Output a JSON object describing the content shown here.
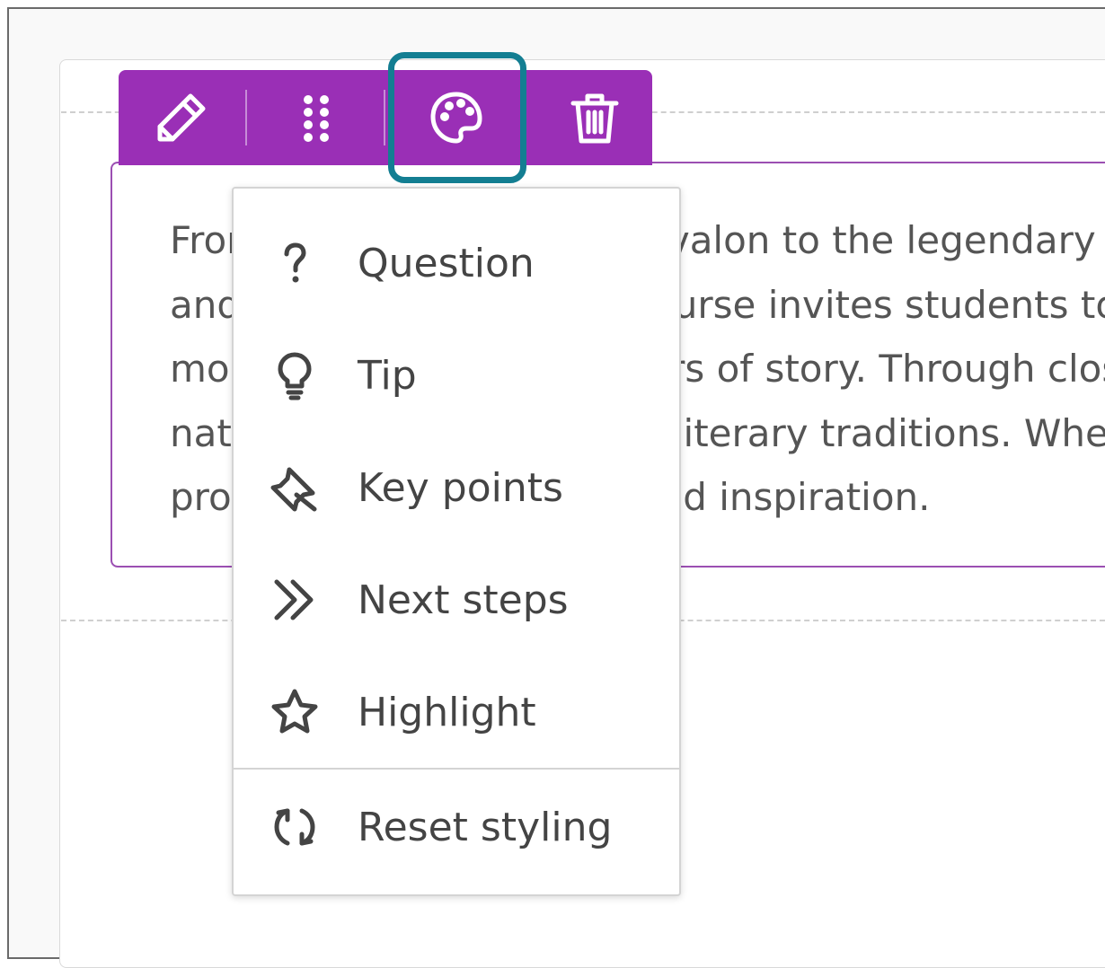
{
  "content": {
    "lines": [
      "From the mystical isle of Avalon to the legendary",
      "and enduring tales, this course invites students to explore",
      "more than a thousand years of story. Through close reading",
      "national identity and later literary traditions. Whether",
      "provides both challenge and inspiration."
    ]
  },
  "toolbar": {
    "edit": "edit",
    "move": "move",
    "style": "style",
    "delete": "delete"
  },
  "menu": {
    "items": [
      {
        "label": "Question",
        "icon": "question-icon"
      },
      {
        "label": "Tip",
        "icon": "lightbulb-icon"
      },
      {
        "label": "Key points",
        "icon": "pin-icon"
      },
      {
        "label": "Next steps",
        "icon": "double-chevron-icon"
      },
      {
        "label": "Highlight",
        "icon": "star-icon"
      },
      {
        "label": "Reset styling",
        "icon": "refresh-icon"
      }
    ]
  },
  "colors": {
    "toolbar": "#9a2fb6",
    "focus_ring": "#137e92",
    "block_border": "#9b4fb2"
  }
}
